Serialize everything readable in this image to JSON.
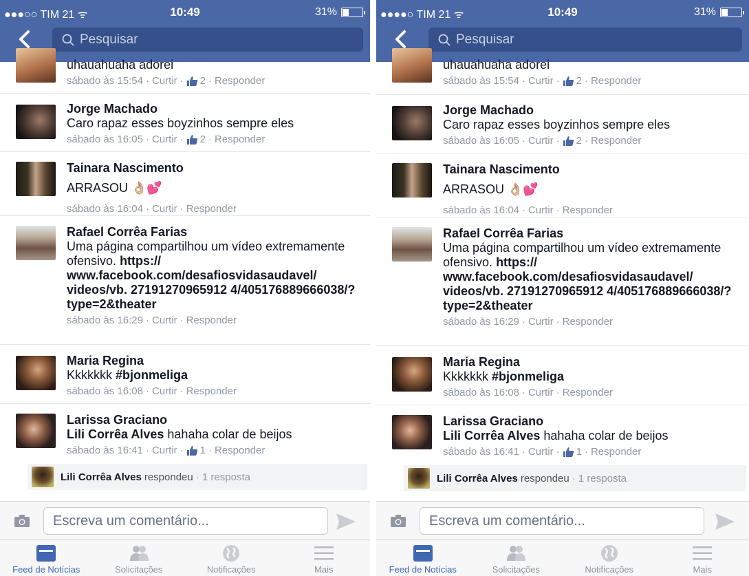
{
  "status_bar": {
    "carrier": "●●●○○ TIM 21 ᯤ",
    "carrier_right": "●●●●○ TIM 21 ᯤ",
    "time": "10:49",
    "battery": "31%",
    "battery_level": 0.31
  },
  "search": {
    "placeholder": "Pesquisar"
  },
  "comments": [
    {
      "name": "",
      "text": "uhauahuaha adorei",
      "time": "sábado às 15:54",
      "like_label": "Curtir",
      "likes": "2",
      "reply_label": "Responder"
    },
    {
      "name": "Jorge Machado",
      "text": "Caro rapaz esses boyzinhos sempre eles",
      "time": "sábado às 16:05",
      "like_label": "Curtir",
      "likes": "2",
      "reply_label": "Responder"
    },
    {
      "name": "Tainara Nascimento",
      "text": "ARRASOU 👌🏼💕",
      "time": "sábado às 16:04",
      "like_label": "Curtir",
      "reply_label": "Responder"
    },
    {
      "name": "Rafael Corrêa Farias",
      "text_plain": "Uma página compartilhou um vídeo extremamente ofensivo.",
      "link_text": "https:// www.facebook.com/desafiosvidasaudavel/ videos/vb. 27191270965912 4/405176889666038/? type=2&theater",
      "time": "sábado às 16:29",
      "like_label": "Curtir",
      "reply_label": "Responder"
    },
    {
      "name": "Maria Regina",
      "text_plain": "Kkkkkkk",
      "hashtag": "#bjonmeliga",
      "time": "sábado às 16:08",
      "like_label": "Curtir",
      "reply_label": "Responder"
    },
    {
      "name": "Larissa Graciano",
      "mention": "Lili Corrêa Alves",
      "text_plain": "hahaha colar de beijos",
      "time": "sábado às 16:41",
      "like_label": "Curtir",
      "likes": "1",
      "reply_label": "Responder"
    }
  ],
  "reply_summary": {
    "name": "Lili Corrêa Alves",
    "action": "respondeu",
    "count": "1 resposta"
  },
  "composer": {
    "placeholder": "Escreva um comentário..."
  },
  "tabs": [
    {
      "label": "Feed de Notícias",
      "icon": "feed-icon",
      "active": true
    },
    {
      "label": "Solicitações",
      "icon": "friends-icon"
    },
    {
      "label": "Notificações",
      "icon": "globe-icon"
    },
    {
      "label": "Mais",
      "icon": "menu-icon"
    }
  ],
  "colors": {
    "nav": "#4a67a6",
    "search": "#36508b",
    "active_tab": "#4267b2",
    "meta": "#9197a3"
  }
}
